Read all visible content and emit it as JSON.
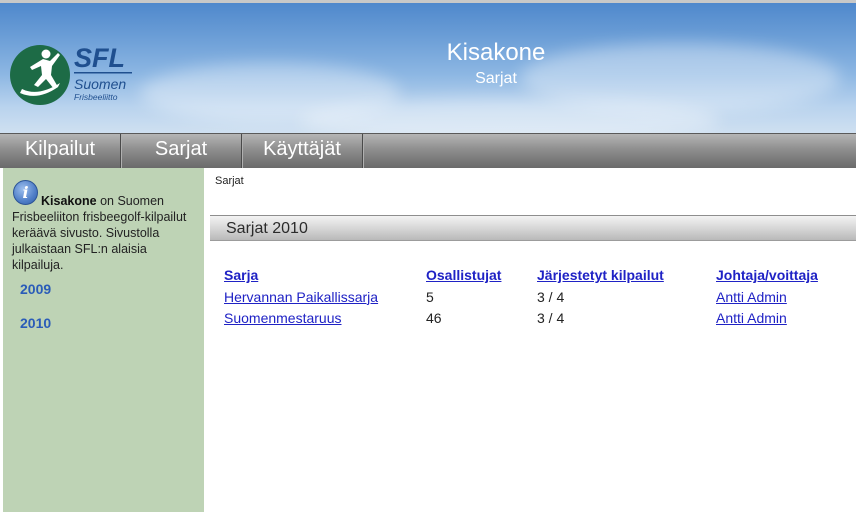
{
  "header": {
    "logo_text": "SFL",
    "logo_subtitle_line1": "Suomen",
    "logo_subtitle_line2": "Frisbeeliitto",
    "title": "Kisakone",
    "subtitle": "Sarjat"
  },
  "nav": {
    "items": [
      {
        "label": "Kilpailut"
      },
      {
        "label": "Sarjat"
      },
      {
        "label": "Käyttäjät"
      }
    ]
  },
  "sidebar": {
    "intro_bold": "Kisakone",
    "intro_rest": " on Suomen Frisbeeliiton frisbeegolf-kilpailut keräävä sivusto. Sivustolla julkaistaan SFL:n alaisia kilpailuja.",
    "years": [
      "2009",
      "2010"
    ]
  },
  "breadcrumb": "Sarjat",
  "section": {
    "title": "Sarjat 2010"
  },
  "table": {
    "headers": [
      "Sarja",
      "Osallistujat",
      "Järjestetyt kilpailut",
      "Johtaja/voittaja"
    ],
    "rows": [
      {
        "name": "Hervannan Paikallissarja",
        "participants": "5",
        "events": "3 / 4",
        "leader": "Antti Admin"
      },
      {
        "name": "Suomenmestaruus",
        "participants": "46",
        "events": "3 / 4",
        "leader": "Antti Admin"
      }
    ]
  },
  "colors": {
    "header_sky": "#6a9dd6",
    "nav_gray": "#8e8e8e",
    "sidebar_green": "#bed3b5",
    "link_blue": "#1f22c5",
    "logo_green": "#1d6b46",
    "logo_blue": "#1f4f8f"
  }
}
